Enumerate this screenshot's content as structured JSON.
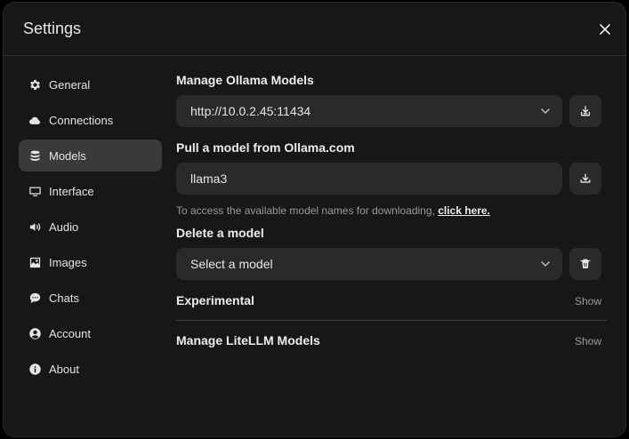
{
  "title": "Settings",
  "sidebar": {
    "items": [
      {
        "label": "General",
        "icon": "gear-icon"
      },
      {
        "label": "Connections",
        "icon": "cloud-icon"
      },
      {
        "label": "Models",
        "icon": "database-icon"
      },
      {
        "label": "Interface",
        "icon": "monitor-icon"
      },
      {
        "label": "Audio",
        "icon": "speaker-icon"
      },
      {
        "label": "Images",
        "icon": "image-icon"
      },
      {
        "label": "Chats",
        "icon": "chat-bubble-icon"
      },
      {
        "label": "Account",
        "icon": "user-circle-icon"
      },
      {
        "label": "About",
        "icon": "info-icon"
      }
    ],
    "active": "Models"
  },
  "main": {
    "manage_title": "Manage Ollama Models",
    "ollama_url": "http://10.0.2.45:11434",
    "pull_title": "Pull a model from Ollama.com",
    "pull_input_value": "llama3",
    "hint_text": "To access the available model names for downloading,",
    "hint_link": "click here.",
    "delete_title": "Delete a model",
    "delete_placeholder": "Select a model",
    "experimental_label": "Experimental",
    "experimental_show": "Show",
    "litellm_label": "Manage LiteLLM Models",
    "litellm_show": "Show"
  }
}
